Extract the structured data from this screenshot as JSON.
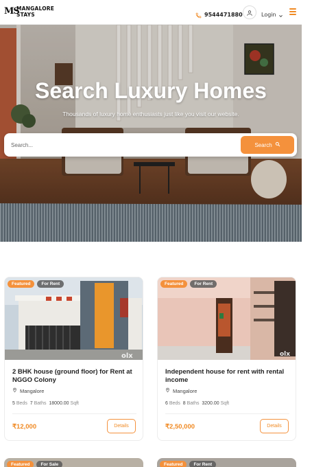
{
  "header": {
    "logo_mark": "MS",
    "logo_line1": "MANGALORE",
    "logo_line2": "STAYS",
    "phone": "9544471880",
    "login_label": "Login",
    "icons": [
      "phone-icon",
      "user-icon",
      "chevron-down-icon",
      "hamburger-menu-icon"
    ]
  },
  "hero": {
    "title": "Search Luxury Homes",
    "subtitle": "Thousands of luxury home enthusiasts just like you visit our website.",
    "search_placeholder": "Search...",
    "search_button": "Search"
  },
  "colors": {
    "accent": "#f4913c",
    "price": "#f08a24"
  },
  "listings": [
    {
      "badges": [
        "Featured",
        "For Rent"
      ],
      "title": "2 BHK house (ground floor) for Rent at NGGO Colony",
      "location": "Mangalore",
      "beds": "5",
      "beds_label": "Beds",
      "baths": "7",
      "baths_label": "Baths",
      "area": "18000.00",
      "area_unit": "Sqft",
      "price": "₹12,000",
      "details_label": "Details"
    },
    {
      "badges": [
        "Featured",
        "For Rent"
      ],
      "title": "Independent house for rent with rental income",
      "location": "Mangalore",
      "beds": "6",
      "beds_label": "Beds",
      "baths": "8",
      "baths_label": "Baths",
      "area": "3200.00",
      "area_unit": "Sqft",
      "price": "₹2,50,000",
      "details_label": "Details"
    },
    {
      "badges": [
        "Featured",
        "For Sale"
      ]
    },
    {
      "badges": [
        "Featured",
        "For Rent"
      ]
    }
  ]
}
